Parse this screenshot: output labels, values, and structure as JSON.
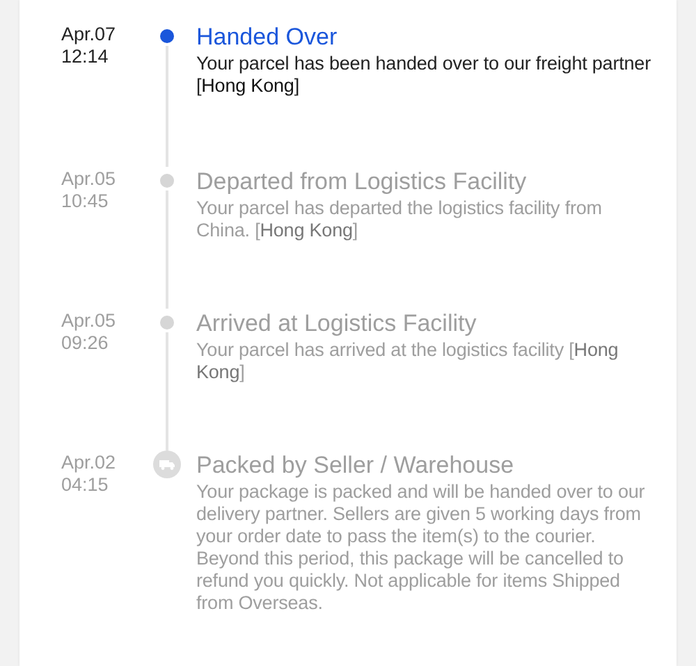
{
  "events": [
    {
      "date": "Apr.07",
      "time": "12:14",
      "title": "Handed Over",
      "description": "Your parcel has been handed over to our freight partner [**Hong Kong**]",
      "active": true,
      "kind": "dot"
    },
    {
      "date": "Apr.05",
      "time": "10:45",
      "title": "Departed from Logistics Facility",
      "description": "Your parcel has departed the logistics facility from China. [**Hong Kong**]",
      "active": false,
      "kind": "dot"
    },
    {
      "date": "Apr.05",
      "time": "09:26",
      "title": "Arrived at Logistics Facility",
      "description": "Your parcel has arrived at the logistics facility [**Hong Kong**]",
      "active": false,
      "kind": "dot"
    },
    {
      "date": "Apr.02",
      "time": "04:15",
      "title": "Packed by Seller / Warehouse",
      "description": "Your package is packed and will be handed over to our delivery partner. Sellers are given 5 working days from your order date to pass the item(s) to the courier. Beyond this period, this package will be cancelled to refund you quickly. Not applicable for items Shipped from Overseas.",
      "active": false,
      "kind": "truck"
    }
  ]
}
